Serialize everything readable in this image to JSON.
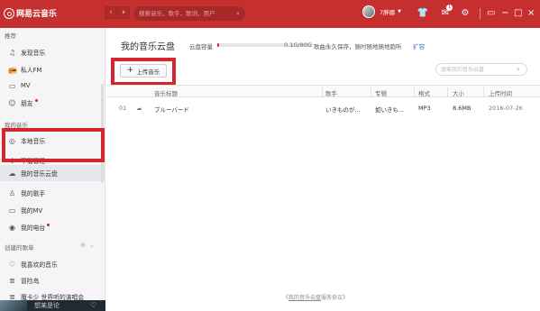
{
  "app": {
    "logo_text": "网易云音乐",
    "accent": "#c62f2f"
  },
  "topbar": {
    "back_label": "‹",
    "forward_label": "›",
    "search_placeholder": "搜索音乐，歌手，歌词，用户",
    "username": "7胖娜",
    "mail_badge": "1"
  },
  "sidebar": {
    "sections": [
      {
        "title": "推荐"
      },
      {
        "title": "我的音乐"
      },
      {
        "title": "创建的歌单"
      }
    ],
    "recommend_items": [
      {
        "label": "发现音乐",
        "icon": "music-note-icon"
      },
      {
        "label": "私人FM",
        "icon": "radio-icon"
      },
      {
        "label": "MV",
        "icon": "video-icon"
      },
      {
        "label": "朋友",
        "icon": "friends-icon"
      }
    ],
    "mymusic_items": [
      {
        "label": "本地音乐",
        "icon": "disc-icon"
      },
      {
        "label": "下载管理",
        "icon": "download-icon"
      },
      {
        "label": "我的音乐云盘",
        "icon": "cloud-icon"
      },
      {
        "label": "我的歌手",
        "icon": "user-icon"
      },
      {
        "label": "我的MV",
        "icon": "video-icon"
      },
      {
        "label": "我的电台",
        "icon": "radio-icon"
      }
    ],
    "playlist_items": [
      {
        "label": "我喜欢的音乐",
        "icon": "heart-icon"
      },
      {
        "label": "冒险岛",
        "icon": "playlist-icon"
      },
      {
        "label": "魔卡少 世界听的演唱会",
        "icon": "playlist-icon"
      }
    ],
    "player_title": "想某是论"
  },
  "main": {
    "title": "我的音乐云盘",
    "capacity_label": "云盘容量",
    "capacity_value": "0.1G/80G",
    "capacity_fraction": 0.00125,
    "capacity_note": "歌曲永久保存，随时随地随地跑听",
    "expand_link": "扩容",
    "upload_label": "上传音乐",
    "search_placeholder": "搜索我的音乐云盘",
    "columns": [
      "音乐标题",
      "歌手",
      "专辑",
      "格式",
      "大小",
      "上传时间"
    ],
    "rows": [
      {
        "index": "01",
        "title": "ブルーバード",
        "artist": "いきものが...",
        "album": "如いきも...",
        "format": "MP3",
        "size": "8.6MB",
        "date": "2016-07-26"
      }
    ],
    "footer_prefix": "《",
    "footer_link": "我的音乐云盘",
    "footer_suffix": "服务协议》"
  }
}
